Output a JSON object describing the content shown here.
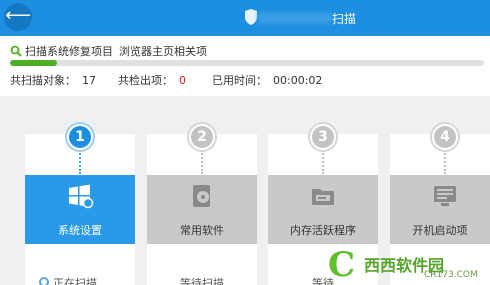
{
  "header": {
    "back_glyph": "⟵",
    "title": "扫描"
  },
  "status": {
    "scan_label": "扫描系统修复项目",
    "scan_item": "浏览器主页相关项",
    "progress": 0.1,
    "stats": [
      {
        "label": "共扫描对象：",
        "value": "17"
      },
      {
        "label": "共检出项：",
        "value": "0"
      },
      {
        "label": "已用时间：",
        "value": "00:00:02"
      }
    ]
  },
  "steps": [
    {
      "num": "1",
      "label": "系统设置",
      "icon": "windows-icon",
      "sub": "正在扫描",
      "active": true
    },
    {
      "num": "2",
      "label": "常用软件",
      "icon": "software-icon",
      "sub": "等待扫描",
      "active": false
    },
    {
      "num": "3",
      "label": "内存活跃程序",
      "icon": "memory-program-icon",
      "sub": "等待",
      "active": false
    },
    {
      "num": "4",
      "label": "开机启动项",
      "icon": "startup-icon",
      "sub": "",
      "active": false
    }
  ],
  "watermark": {
    "name": "西西软件园",
    "url": "CR173.COM"
  },
  "colors": {
    "accent": "#1c8fe0",
    "progress": "#4caf1f",
    "alert": "#e02020",
    "inactive_tile": "#c9c9c9"
  }
}
